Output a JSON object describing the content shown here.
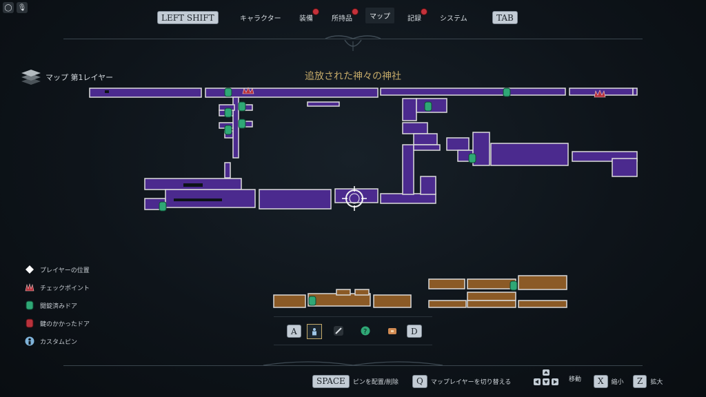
{
  "top_left_icons": [
    "q-icon",
    "microphone-icon"
  ],
  "nav": {
    "left_key": "LEFT SHIFT",
    "right_key": "TAB",
    "tabs": [
      {
        "label": "キャラクター",
        "alert": false
      },
      {
        "label": "装備",
        "alert": true
      },
      {
        "label": "所持品",
        "alert": true
      },
      {
        "label": "マップ",
        "alert": false,
        "active": true
      },
      {
        "label": "記録",
        "alert": true
      },
      {
        "label": "システム",
        "alert": false
      }
    ]
  },
  "layer": {
    "label": "マップ 第1レイヤー"
  },
  "map": {
    "title": "追放された神々の神社",
    "colors": {
      "explored": "#4b2a8e",
      "lower_layer": "#8b5a26",
      "unlocked_door": "#2fa876",
      "checkpoint": "#b8323c"
    }
  },
  "legend": [
    {
      "icon": "player-position-icon",
      "label": "プレイヤーの位置"
    },
    {
      "icon": "checkpoint-icon",
      "label": "チェックポイント"
    },
    {
      "icon": "unlocked-door-icon",
      "label": "開錠済みドア"
    },
    {
      "icon": "locked-door-icon",
      "label": "鍵のかかったドア"
    },
    {
      "icon": "custom-pin-icon",
      "label": "カスタムピン"
    }
  ],
  "pins": {
    "left_key": "A",
    "right_key": "D",
    "items": [
      "person-pin-icon",
      "sword-pin-icon",
      "question-pin-icon",
      "chest-pin-icon"
    ]
  },
  "footer": {
    "space_key": "SPACE",
    "space_label": "ピンを配置/削除",
    "q_key": "Q",
    "q_label": "マップレイヤーを切り替える",
    "move_label": "移動",
    "x_key": "X",
    "x_label": "縮小",
    "z_key": "Z",
    "z_label": "拡大"
  }
}
